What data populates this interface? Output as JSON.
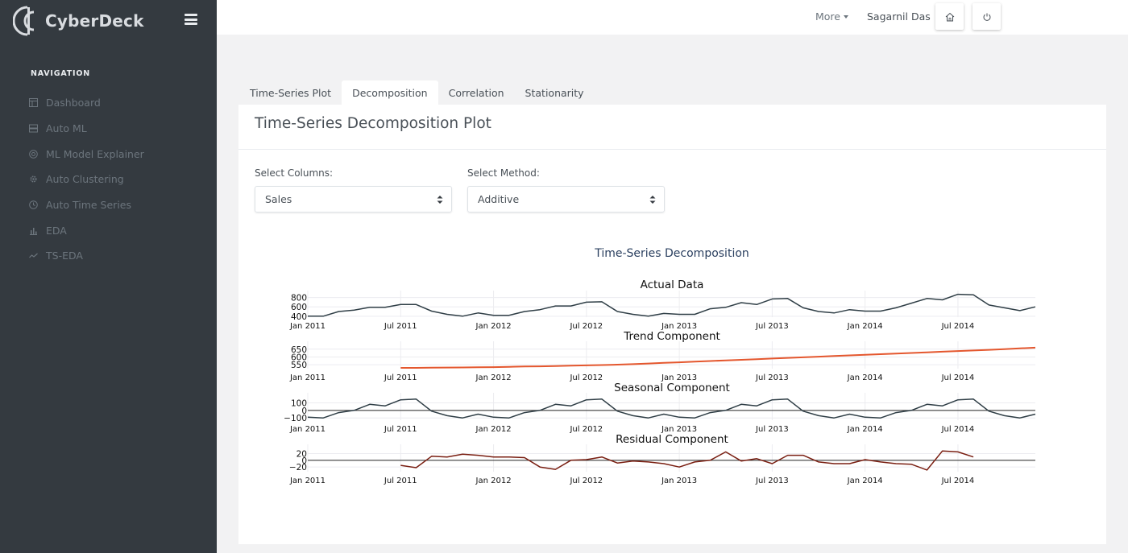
{
  "app": {
    "name": "CyberDeck"
  },
  "sidebar": {
    "section_title": "NAVIGATION",
    "items": [
      {
        "label": "Dashboard",
        "icon": "dashboard-icon"
      },
      {
        "label": "Auto ML",
        "icon": "server-icon"
      },
      {
        "label": "ML Model Explainer",
        "icon": "globe-icon"
      },
      {
        "label": "Auto Clustering",
        "icon": "gear-icon"
      },
      {
        "label": "Auto Time Series",
        "icon": "clock-icon"
      },
      {
        "label": "EDA",
        "icon": "bar-chart-icon"
      },
      {
        "label": "TS-EDA",
        "icon": "trend-line-icon"
      }
    ]
  },
  "topbar": {
    "more_label": "More",
    "user_name": "Sagarnil Das"
  },
  "tabs": [
    {
      "label": "Time-Series Plot",
      "active": false
    },
    {
      "label": "Decomposition",
      "active": true
    },
    {
      "label": "Correlation",
      "active": false
    },
    {
      "label": "Stationarity",
      "active": false
    }
  ],
  "card": {
    "title": "Time-Series Decomposition Plot",
    "columns_label": "Select Columns:",
    "columns_value": "Sales",
    "method_label": "Select Method:",
    "method_value": "Additive"
  },
  "colors": {
    "sidebar_bg": "#343a40",
    "line_dark": "#2f3e46",
    "trend": "#e4572e",
    "residual": "#7a1f12"
  },
  "chart_data": {
    "type": "line",
    "title": "Time-Series Decomposition",
    "x_start": "Jan 2011",
    "x_ticks": [
      "Jan 2011",
      "Jul 2011",
      "Jan 2012",
      "Jul 2012",
      "Jan 2013",
      "Jul 2013",
      "Jan 2014",
      "Jul 2014"
    ],
    "panels": [
      {
        "title": "Actual Data",
        "yticks": [
          "800",
          "600",
          "400"
        ],
        "ylim": [
          380,
          880
        ],
        "color": "#2f3e46",
        "values": [
          400,
          400,
          500,
          530,
          590,
          590,
          650,
          650,
          510,
          440,
          400,
          470,
          420,
          420,
          500,
          540,
          620,
          620,
          700,
          710,
          500,
          440,
          400,
          460,
          440,
          440,
          560,
          590,
          690,
          650,
          770,
          780,
          580,
          500,
          470,
          540,
          510,
          510,
          580,
          680,
          780,
          750,
          870,
          860,
          640,
          580,
          520,
          600
        ]
      },
      {
        "title": "Trend Component",
        "yticks": [
          "650",
          "600",
          "550"
        ],
        "ylim": [
          525,
          680
        ],
        "color": "#e4572e",
        "start_index": 6,
        "values": [
          530,
          530,
          531,
          532,
          533,
          534,
          535,
          537,
          539,
          540,
          542,
          544,
          546,
          548,
          551,
          554,
          558,
          562,
          566,
          570,
          574,
          578,
          582,
          586,
          590,
          594,
          598,
          602,
          606,
          610,
          614,
          618,
          622,
          626,
          630,
          634,
          638,
          642,
          646,
          650,
          655,
          660
        ]
      },
      {
        "title": "Seasonal Component",
        "yticks": [
          "100",
          "0",
          "−100"
        ],
        "ylim": [
          -130,
          190
        ],
        "zero_line": true,
        "color": "#2f3e46",
        "values": [
          -90,
          -100,
          -30,
          0,
          80,
          60,
          140,
          150,
          -10,
          -70,
          -100,
          -50,
          -90,
          -100,
          -30,
          0,
          80,
          60,
          140,
          150,
          -10,
          -70,
          -100,
          -50,
          -90,
          -100,
          -30,
          0,
          80,
          60,
          140,
          150,
          -10,
          -70,
          -100,
          -50,
          -90,
          -100,
          -30,
          0,
          80,
          60,
          140,
          150,
          -10,
          -70,
          -100,
          -50
        ]
      },
      {
        "title": "Residual Component",
        "yticks": [
          "20",
          "0",
          "−20"
        ],
        "ylim": [
          -34,
          38
        ],
        "zero_line": true,
        "color": "#7a1f12",
        "start_index": 6,
        "values": [
          -15,
          -22,
          12,
          10,
          18,
          15,
          10,
          10,
          8,
          -20,
          -27,
          0,
          2,
          10,
          -8,
          -2,
          -5,
          -10,
          -20,
          -5,
          0,
          25,
          -2,
          5,
          -10,
          15,
          15,
          -5,
          -10,
          -10,
          2,
          -5,
          -10,
          -12,
          -29,
          28,
          25,
          10
        ]
      }
    ]
  }
}
